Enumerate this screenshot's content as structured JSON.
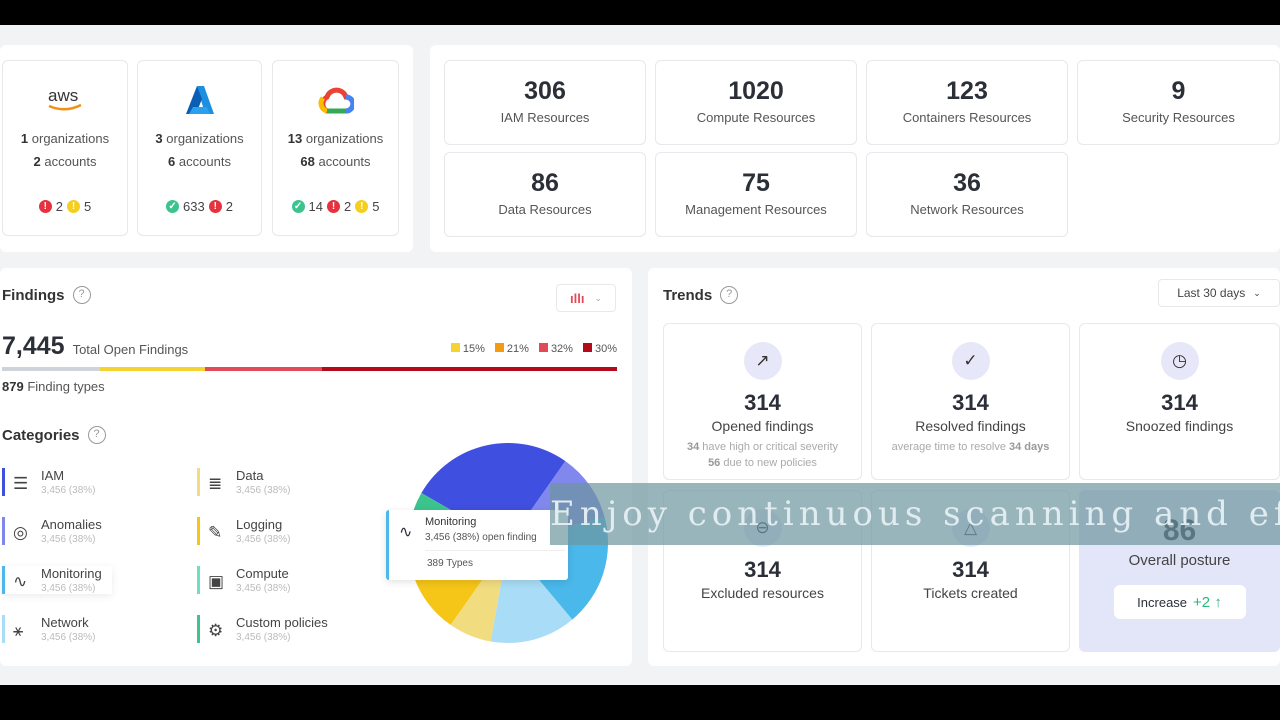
{
  "providers": [
    {
      "name": "aws",
      "orgs": "1",
      "orgs_label": "organizations",
      "accounts": "2",
      "accounts_label": "accounts",
      "status": [
        {
          "type": "error",
          "count": "2"
        },
        {
          "type": "warning",
          "count": "5"
        }
      ]
    },
    {
      "name": "Azure",
      "orgs": "3",
      "orgs_label": "organizations",
      "accounts": "6",
      "accounts_label": "accounts",
      "status": [
        {
          "type": "ok",
          "count": "633"
        },
        {
          "type": "error",
          "count": "2"
        }
      ]
    },
    {
      "name": "Google Cloud",
      "orgs": "13",
      "orgs_label": "organizations",
      "accounts": "68",
      "accounts_label": "accounts",
      "status": [
        {
          "type": "ok",
          "count": "14"
        },
        {
          "type": "error",
          "count": "2"
        },
        {
          "type": "warning",
          "count": "5"
        }
      ]
    }
  ],
  "resources": [
    {
      "count": "306",
      "label": "IAM Resources"
    },
    {
      "count": "1020",
      "label": "Compute Resources"
    },
    {
      "count": "123",
      "label": "Containers Resources"
    },
    {
      "count": "9",
      "label": "Security Resources"
    },
    {
      "count": "86",
      "label": "Data Resources"
    },
    {
      "count": "75",
      "label": "Management Resources"
    },
    {
      "count": "36",
      "label": "Network Resources"
    }
  ],
  "findings": {
    "title": "Findings",
    "help": "?",
    "total": "7,445",
    "total_label": "Total Open Findings",
    "types": "879",
    "types_label": "Finding types",
    "severity": [
      {
        "pct": "15%",
        "value": 15,
        "color": "#f5d431"
      },
      {
        "pct": "21%",
        "value": 21,
        "color": "#f39c12"
      },
      {
        "pct": "32%",
        "value": 32,
        "color": "#e24a57"
      },
      {
        "pct": "30%",
        "value": 30,
        "color": "#b50a1c"
      }
    ]
  },
  "categories": {
    "title": "Categories",
    "help": "?",
    "items": [
      {
        "name": "IAM",
        "value": "3,456 (38%)",
        "icon": "fingerprint-icon",
        "glyph": "☰",
        "color": "#3f4fe0"
      },
      {
        "name": "Anomalies",
        "value": "3,456 (38%)",
        "icon": "radar-icon",
        "glyph": "◎",
        "color": "#8088ee"
      },
      {
        "name": "Monitoring",
        "value": "3,456 (38%)",
        "icon": "pulse-icon",
        "glyph": "∿",
        "color": "#4ab8ea"
      },
      {
        "name": "Network",
        "value": "3,456 (38%)",
        "icon": "network-icon",
        "glyph": "⚹",
        "color": "#a9dcf6"
      },
      {
        "name": "Data",
        "value": "3,456 (38%)",
        "icon": "database-icon",
        "glyph": "≣",
        "color": "#f2dc80"
      },
      {
        "name": "Logging",
        "value": "3,456 (38%)",
        "icon": "edit-log-icon",
        "glyph": "✎",
        "color": "#f5c518"
      },
      {
        "name": "Compute",
        "value": "3,456 (38%)",
        "icon": "chip-icon",
        "glyph": "▣",
        "color": "#6ee0c0"
      },
      {
        "name": "Custom policies",
        "value": "3,456 (38%)",
        "icon": "gear-shield-icon",
        "glyph": "⚙",
        "color": "#3cc48e"
      }
    ],
    "tooltip": {
      "name": "Monitoring",
      "detail": "3,456 (38%) open finding",
      "types": "389 Types"
    }
  },
  "chart_data": {
    "type": "pie",
    "title": "Categories",
    "categories": [
      "IAM",
      "Anomalies",
      "Monitoring",
      "Network",
      "Data",
      "Logging",
      "Compute",
      "Custom policies"
    ],
    "values": [
      95,
      40,
      65,
      50,
      25,
      35,
      30,
      20
    ],
    "colors": [
      "#3f4fe0",
      "#8088ee",
      "#4ab8ea",
      "#a9dcf6",
      "#f2dc80",
      "#f5c518",
      "#6ee0c0",
      "#3cc48e"
    ]
  },
  "trends": {
    "title": "Trends",
    "help": "?",
    "range": "Last 30 days",
    "cards": [
      {
        "count": "314",
        "label": "Opened findings",
        "icon": "trending-up-icon",
        "glyph": "↗",
        "sub1_b": "34",
        "sub1": " have high or critical severity",
        "sub2_b": "56",
        "sub2": " due to new policies"
      },
      {
        "count": "314",
        "label": "Resolved findings",
        "icon": "check-circle-icon",
        "glyph": "✓",
        "sub1": "average time to resolve ",
        "sub1_b2": "34 days"
      },
      {
        "count": "314",
        "label": "Snoozed findings",
        "icon": "clock-icon",
        "glyph": "◷"
      },
      {
        "count": "314",
        "label": "Excluded resources",
        "icon": "minus-circle-icon",
        "glyph": "⊖"
      },
      {
        "count": "314",
        "label": "Tickets created",
        "icon": "ticket-icon",
        "glyph": "△"
      }
    ],
    "posture": {
      "value": "86",
      "label": "Overall posture",
      "change_label": "Increase",
      "change": "+2 ↑"
    }
  },
  "subtitle": "Enjoy continuous scanning and effo"
}
